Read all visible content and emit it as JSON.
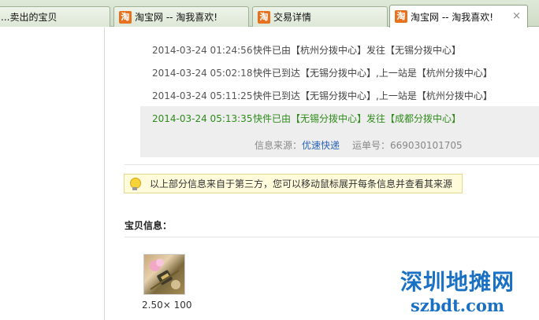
{
  "tabs": [
    {
      "label": "...卖出的宝贝",
      "icon": "",
      "active": false
    },
    {
      "label": "淘宝网 -- 淘我喜欢!",
      "icon": "淘",
      "active": false
    },
    {
      "label": "交易详情",
      "icon": "淘",
      "active": false
    },
    {
      "label": "淘宝网 -- 淘我喜欢!",
      "icon": "淘",
      "active": true,
      "close": "×"
    }
  ],
  "logistics": [
    {
      "time": "2014-03-24 01:24:56",
      "text": "快件已由【杭州分拨中心】发往【无锡分拨中心】"
    },
    {
      "time": "2014-03-24 05:02:18",
      "text": "快件已到达【无锡分拨中心】,上一站是【杭州分拨中心】"
    },
    {
      "time": "2014-03-24 05:11:25",
      "text": "快件已到达【无锡分拨中心】,上一站是【杭州分拨中心】"
    },
    {
      "time": "2014-03-24 05:13:35",
      "text": "快件已由【无锡分拨中心】发往【成都分拨中心】"
    }
  ],
  "source": {
    "label": "信息来源：",
    "carrier": "优速快递",
    "tracking": "运单号：669030101705"
  },
  "tip": "以上部分信息来自于第三方，您可以移动鼠标展开每条信息并查看其来源",
  "item_section": {
    "title": "宝贝信息：",
    "price": "2.50× 100"
  },
  "watermark": {
    "cn": "深圳地摊网",
    "en": "szbdt.com"
  },
  "colors": {
    "latest_green": "#2e8b1a",
    "link_blue": "#2a63b8",
    "watermark_blue": "#1a71c4",
    "tip_bg": "#fffbdb"
  }
}
